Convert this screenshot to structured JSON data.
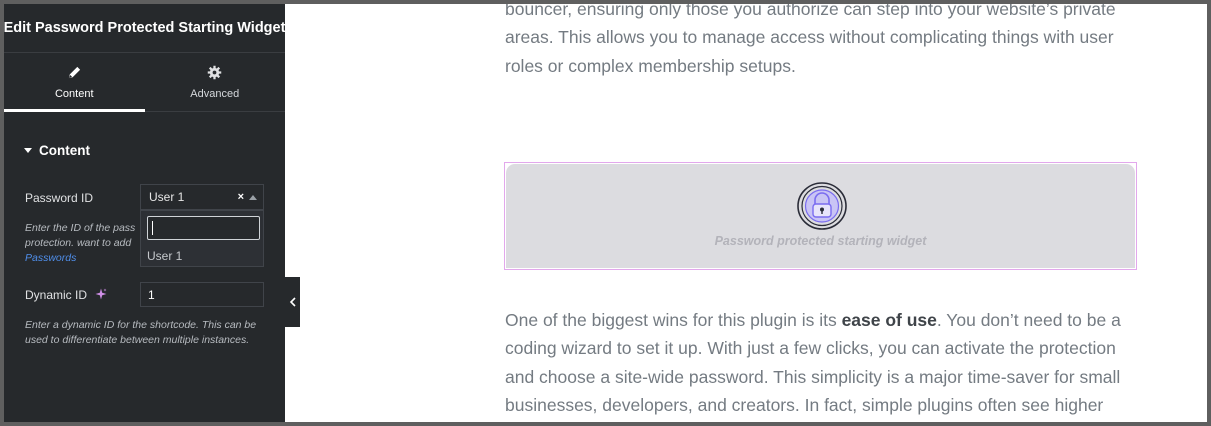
{
  "panel": {
    "title": "Edit Password Protected Starting Widget",
    "tabs": [
      {
        "label": "Content",
        "icon": "pencil-icon",
        "active": true
      },
      {
        "label": "Advanced",
        "icon": "gear-icon",
        "active": false
      }
    ],
    "section_title": "Content",
    "password_id": {
      "label": "Password ID",
      "value": "User 1",
      "clear_glyph": "×",
      "dropdown_search": "",
      "options": [
        "User 1"
      ],
      "help_line1": "Enter the ID of the pass",
      "help_line2": "protection. want to add",
      "help_link": "Passwords"
    },
    "dynamic_id": {
      "label": "Dynamic ID",
      "value": "1",
      "help": "Enter a dynamic ID for the shortcode. This can be used to differentiate between multiple instances."
    }
  },
  "page": {
    "para_top": [
      "bouncer, ensuring only those you authorize can step into your website’s private",
      "areas. This allows you to manage access without complicating things with user",
      "roles or complex membership setups."
    ],
    "widget_label": "Password protected starting widget",
    "para_bottom": {
      "l1_pre": "One of the biggest wins for this plugin is its ",
      "l1_bold": "ease of use",
      "l1_post": ". You don’t need to be a",
      "l2": "coding wizard to set it up. With just a few clicks, you can activate the protection",
      "l3": "and choose a site-wide password. This simplicity is a major time-saver for small",
      "l4": "businesses, developers, and creators. In fact, simple plugins often see higher"
    }
  },
  "colors": {
    "panel_bg": "#26292c",
    "link": "#4f8de8",
    "widget_border": "#e2a8ec",
    "widget_bg": "#dcdce0",
    "lock_accent": "#7a6cf0"
  }
}
